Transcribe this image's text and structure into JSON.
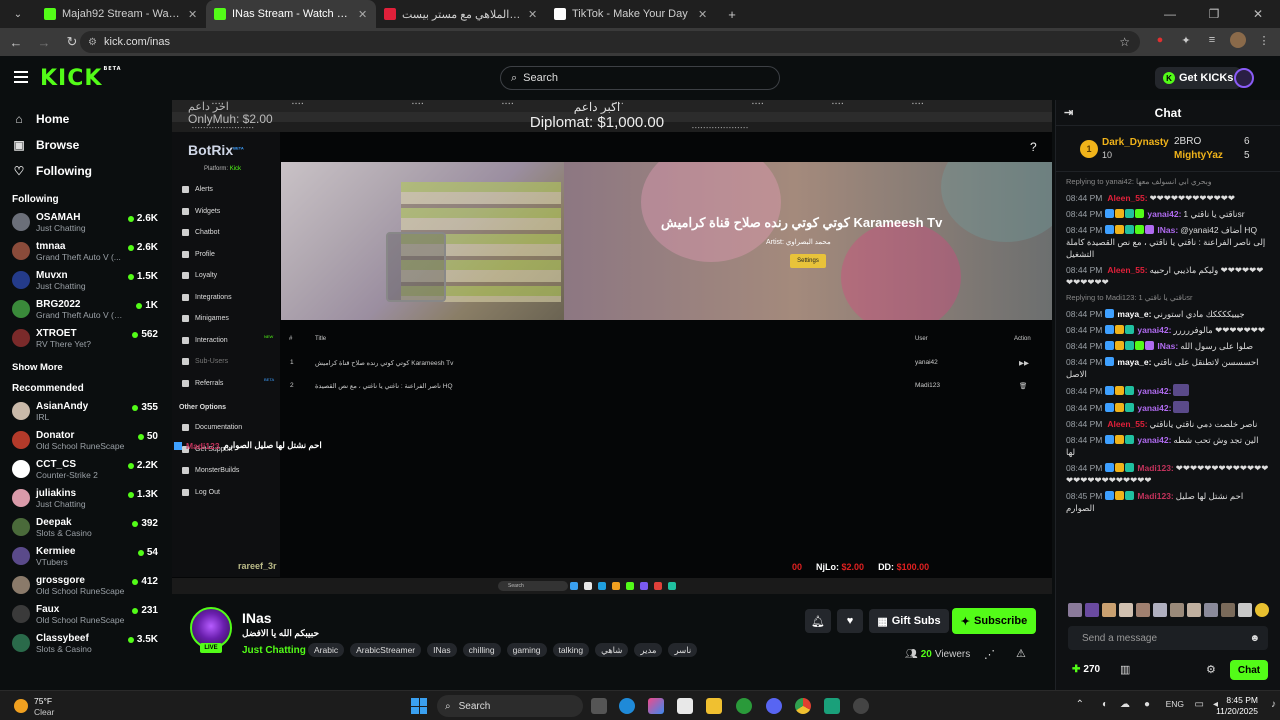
{
  "browser": {
    "tabs": [
      {
        "title": "Majah92 Stream - Watch Live o",
        "color": "#53fc18",
        "active": false
      },
      {
        "title": "INas Stream - Watch Live on Ki",
        "color": "#53fc18",
        "active": true
      },
      {
        "title": "تحدي الملاهي مع مستر بيست",
        "color": "#e0203a",
        "active": false
      },
      {
        "title": "TikTok - Make Your Day",
        "color": "#ffffff",
        "active": false
      }
    ],
    "new_tab": "+",
    "url": "kick.com/inas"
  },
  "header": {
    "logo": "KICK",
    "logo_badge": "BETA",
    "search_placeholder": "Search",
    "get_kicks": "Get KICKs"
  },
  "sidebar": {
    "nav": [
      {
        "label": "Home",
        "icon": "home-icon",
        "glyph": "⌂"
      },
      {
        "label": "Browse",
        "icon": "browse-icon",
        "glyph": "▣"
      },
      {
        "label": "Following",
        "icon": "heart-icon",
        "glyph": "♡"
      }
    ],
    "following_title": "Following",
    "following": [
      {
        "name": "OSAMAH",
        "category": "Just Chatting",
        "viewers": "2.6K",
        "color": "#6b6f79"
      },
      {
        "name": "tmnaa",
        "category": "Grand Theft Auto V (...",
        "viewers": "2.6K",
        "color": "#8a4b3a"
      },
      {
        "name": "Muvxn",
        "category": "Just Chatting",
        "viewers": "1.5K",
        "color": "#243b8a"
      },
      {
        "name": "BRG2022",
        "category": "Grand Theft Auto V (GTA)",
        "viewers": "1K",
        "color": "#3a8a3a"
      },
      {
        "name": "XTROET",
        "category": "RV There Yet?",
        "viewers": "562",
        "color": "#7a2a2a"
      }
    ],
    "show_more": "Show More",
    "recommended_title": "Recommended",
    "recommended": [
      {
        "name": "AsianAndy",
        "category": "IRL",
        "viewers": "355",
        "color": "#c9b9a9"
      },
      {
        "name": "Donator",
        "category": "Old School RuneScape",
        "viewers": "50",
        "color": "#b33a2a"
      },
      {
        "name": "CCT_CS",
        "category": "Counter-Strike 2",
        "viewers": "2.2K",
        "color": "#ffffff"
      },
      {
        "name": "juliakins",
        "category": "Just Chatting",
        "viewers": "1.3K",
        "color": "#d99aa9"
      },
      {
        "name": "Deepak",
        "category": "Slots & Casino",
        "viewers": "392",
        "color": "#4a6a3a"
      },
      {
        "name": "Kermiee",
        "category": "VTubers",
        "viewers": "54",
        "color": "#5a4a8a"
      },
      {
        "name": "grossgore",
        "category": "Old School RuneScape",
        "viewers": "412",
        "color": "#8a7a6a"
      },
      {
        "name": "Faux",
        "category": "Old School RuneScape",
        "viewers": "231",
        "color": "#3a3a3a"
      },
      {
        "name": "Classybeef",
        "category": "Slots & Casino",
        "viewers": "3.5K",
        "color": "#2a6a4a"
      }
    ]
  },
  "video": {
    "brand": "BotRix",
    "brand_badge": "BETA",
    "platform_label": "Platform:",
    "platform_value": "Kick",
    "menu": [
      {
        "label": "Alerts",
        "dim": false
      },
      {
        "label": "Widgets",
        "dim": false
      },
      {
        "label": "Chatbot",
        "dim": false
      },
      {
        "label": "Profile",
        "dim": false
      },
      {
        "label": "Loyalty",
        "dim": false
      },
      {
        "label": "Integrations",
        "dim": false
      },
      {
        "label": "Minigames",
        "dim": false
      },
      {
        "label": "Interaction",
        "dim": false,
        "tag": "NEW"
      },
      {
        "label": "Sub-Users",
        "dim": true
      },
      {
        "label": "Referrals",
        "dim": false,
        "tag": "BETA"
      }
    ],
    "other_options": "Other Options",
    "other_menu": [
      "Documentation",
      "Get Support",
      "MonsterBuilds",
      "Log Out"
    ],
    "song_title": "كوتي كوتي رنده صلاح قناة كراميش Karameesh Tv",
    "artist_label": "Artist:",
    "artist_name": "محمد البصراوي",
    "settings": "Settings",
    "table_headers": [
      "#",
      "Title",
      "User",
      "Action"
    ],
    "queue": [
      {
        "num": "1",
        "title": "كوتي كوتي رنده صلاح قناة كراميش Karameesh Tv",
        "user": "yanai42"
      },
      {
        "num": "2",
        "title": "ناصر الفراعنة : ناغتي يا ناغتي ، مع نص القصيدة HQ",
        "user": "Madi123"
      }
    ],
    "dono_top": "اكبر داعم",
    "dono_top_amount": "Diplomat: $1,000.00",
    "dono_last": "اخر داعم",
    "dono_last_amount": "OnlyMuh: $2.00",
    "overlay_chat_user": "Madi123",
    "overlay_chat_text": "احم نشتل لها صليل الصوارم",
    "overlay_user": "rareef_3r",
    "stats": [
      {
        "label": "00",
        "value": "",
        "red": true
      },
      {
        "label": "NjLo:",
        "value": "$2.00",
        "red": false
      },
      {
        "label": "DD:",
        "value": "$100.00",
        "red": false
      }
    ],
    "taskbar_search": "Search"
  },
  "stream": {
    "name": "INas",
    "title": "حبيبكم الله يا الافضل",
    "live": "LIVE",
    "category": "Just Chatting",
    "tags": [
      "Arabic",
      "ArabicStreamer",
      "INas",
      "chilling",
      "gaming",
      "talking",
      "شاهي",
      "مدير",
      "ناسر"
    ],
    "gift_subs": "Gift Subs",
    "subscribe": "Subscribe",
    "viewers_count": "20",
    "viewers_label": "Viewers"
  },
  "chat": {
    "title": "Chat",
    "leaderboard": {
      "first_name": "Dark_Dynasty",
      "first_score": "10",
      "first_rank": "1",
      "second_name": "2BRO",
      "second_score": "6",
      "third_name": "MightyYaz",
      "third_score": "5"
    },
    "messages": [
      {
        "reply": "Replying to yanai42: وبحري ابي انسولف معها",
        "time": "",
        "user": "",
        "text": ""
      },
      {
        "reply": "",
        "time": "08:44 PM",
        "user": "Aleen_55:",
        "ucolor": "#e0203a",
        "text": "❤❤❤❤❤❤❤❤❤❤❤❤",
        "badges": 0
      },
      {
        "reply": "",
        "time": "08:44 PM",
        "user": "yanai42:",
        "ucolor": "#b06bf0",
        "text": "ناقتي يا ناقتي 1sr",
        "badges": 4
      },
      {
        "reply": "",
        "time": "08:44 PM",
        "user": "INas:",
        "ucolor": "#b06bf0",
        "text": "@yanai42 أضاف HQ إلى ناصر الفراعنة : ناقتي يا ناقتي ، مع نص القصيدة كاملة التشغيل",
        "badges": 5
      },
      {
        "reply": "",
        "time": "08:44 PM",
        "user": "Aleen_55:",
        "ucolor": "#e0203a",
        "text": "وليكم ماذيبي ارحبيه ❤❤❤❤❤❤❤❤❤❤❤❤",
        "badges": 0
      },
      {
        "reply": "Replying to Madi123: ناقتي يا ناقتي 1sr",
        "time": "",
        "user": "",
        "text": ""
      },
      {
        "reply": "",
        "time": "08:44 PM",
        "user": "maya_e:",
        "ucolor": "#ffffff",
        "text": "جيييككككك مادي استورني",
        "badges": 1
      },
      {
        "reply": "",
        "time": "08:44 PM",
        "user": "yanai42:",
        "ucolor": "#b06bf0",
        "text": "مالوفررررر ❤❤❤❤❤❤❤",
        "badges": 3
      },
      {
        "reply": "",
        "time": "08:44 PM",
        "user": "INas:",
        "ucolor": "#b06bf0",
        "text": "صلوا على رسول الله",
        "badges": 5
      },
      {
        "reply": "",
        "time": "08:44 PM",
        "user": "maya_e:",
        "ucolor": "#ffffff",
        "text": "احسسسن لاتطنقل على ناقتي الاصل",
        "badges": 1
      },
      {
        "reply": "",
        "time": "08:44 PM",
        "user": "yanai42:",
        "ucolor": "#b06bf0",
        "text": "",
        "badges": 3
      },
      {
        "reply": "",
        "time": "08:44 PM",
        "user": "yanai42:",
        "ucolor": "#b06bf0",
        "text": "",
        "badges": 3
      },
      {
        "reply": "",
        "time": "08:44 PM",
        "user": "Aleen_55:",
        "ucolor": "#e0203a",
        "text": "ناصر خلصت دمي ناقتي ياناقتي",
        "badges": 0
      },
      {
        "reply": "",
        "time": "08:44 PM",
        "user": "yanai42:",
        "ucolor": "#b06bf0",
        "text": "الين تجد وش تحب شطه لها",
        "badges": 3
      },
      {
        "reply": "",
        "time": "08:44 PM",
        "user": "Madi123:",
        "ucolor": "#c2325b",
        "text": "❤❤❤❤❤❤❤❤❤❤❤❤❤❤❤❤❤❤❤❤❤❤❤❤❤",
        "badges": 3
      },
      {
        "reply": "",
        "time": "08:45 PM",
        "user": "Madi123:",
        "ucolor": "#c2325b",
        "text": "احم نشتل لها صليل الصوارم",
        "badges": 3
      }
    ],
    "input_placeholder": "Send a message",
    "points": "270",
    "send": "Chat"
  },
  "taskbar": {
    "temp": "75°F",
    "condition": "Clear",
    "search": "Search",
    "lang": "ENG",
    "time": "8:45 PM",
    "date": "11/20/2025"
  }
}
